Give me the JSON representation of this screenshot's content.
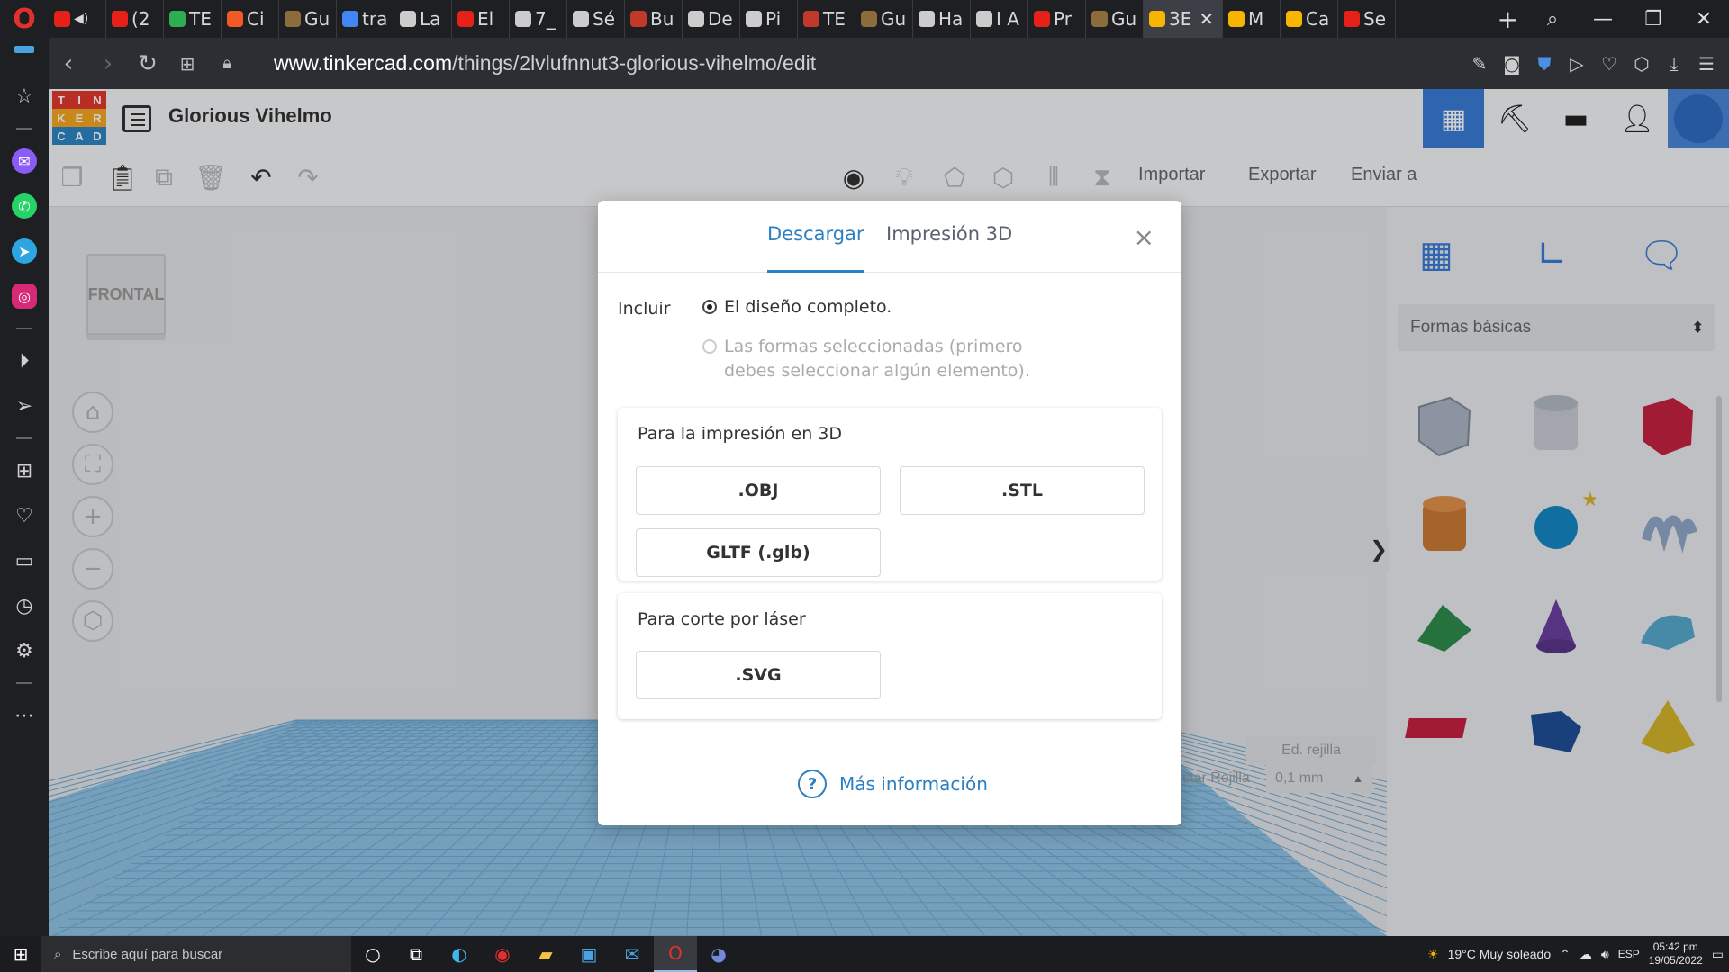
{
  "browser": {
    "tabs": [
      {
        "label": "(2",
        "color": "#e62117"
      },
      {
        "label": "TE",
        "color": "#2eae53"
      },
      {
        "label": "Ci",
        "color": "#f15a24"
      },
      {
        "label": "Gu",
        "color": "#8a6d3b"
      },
      {
        "label": "tra",
        "color": "#4285f4"
      },
      {
        "label": "La",
        "color": "#cccccc"
      },
      {
        "label": "El",
        "color": "#e62117"
      },
      {
        "label": "7_",
        "color": "#cccccc"
      },
      {
        "label": "Sé",
        "color": "#cccccc"
      },
      {
        "label": "Bu",
        "color": "#c0392b"
      },
      {
        "label": "De",
        "color": "#cccccc"
      },
      {
        "label": "Pi",
        "color": "#cccccc"
      },
      {
        "label": "TE",
        "color": "#c0392b"
      },
      {
        "label": "Gu",
        "color": "#8a6d3b"
      },
      {
        "label": "Ha",
        "color": "#cccccc"
      },
      {
        "label": "I A",
        "color": "#cccccc"
      },
      {
        "label": "Pr",
        "color": "#e62117"
      },
      {
        "label": "Gu",
        "color": "#8a6d3b"
      },
      {
        "label": "3E",
        "color": "#f7b500",
        "active": true
      },
      {
        "label": "M",
        "color": "#f7b500"
      },
      {
        "label": "Ca",
        "color": "#f7b500"
      },
      {
        "label": "Se",
        "color": "#e62117"
      }
    ],
    "url_host": "www.tinkercad.com",
    "url_path": "/things/2lvlufnnut3-glorious-vihelmo/edit"
  },
  "app": {
    "design_title": "Glorious Vihelmo",
    "logo_letters": [
      "T",
      "I",
      "N",
      "K",
      "E",
      "R",
      "C",
      "A",
      "D"
    ],
    "toolbar": {
      "import_label": "Importar",
      "export_label": "Exportar",
      "send_label": "Enviar a"
    },
    "viewcube_label": "FRONTAL",
    "edit_grid_label": "Ed. rejilla",
    "snap_label": "Ajustar Rejilla",
    "snap_value": "0,1 mm",
    "shapes_category": "Formas básicas"
  },
  "modal": {
    "tab_download": "Descargar",
    "tab_print": "Impresión 3D",
    "close": "×",
    "include_label": "Incluir",
    "option_full": "El diseño completo.",
    "option_selected": "Las formas seleccionadas (primero debes seleccionar algún elemento).",
    "section_3d": "Para la impresión en 3D",
    "btn_obj": ".OBJ",
    "btn_stl": ".STL",
    "btn_gltf": "GLTF (.glb)",
    "section_laser": "Para corte por láser",
    "btn_svg": ".SVG",
    "more_info": "Más información"
  },
  "taskbar": {
    "search_placeholder": "Escribe aquí para buscar",
    "weather": "19°C  Muy soleado",
    "lang": "ESP",
    "time": "05:42 pm",
    "date": "19/05/2022"
  },
  "colors": {
    "accent": "#2c7fc1",
    "header_active": "#3a7bd5"
  }
}
